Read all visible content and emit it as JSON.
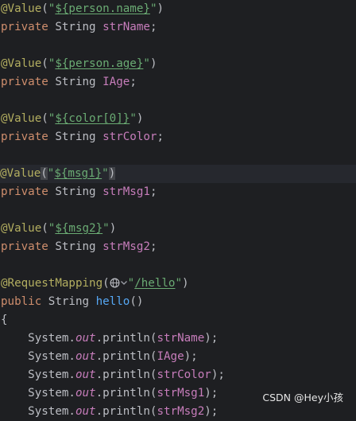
{
  "code": {
    "l1": {
      "anno": "@Value",
      "open": "(",
      "q1": "\"",
      "expr": "${person.name}",
      "q2": "\"",
      "close": ")"
    },
    "l2": {
      "kw": "private",
      "type": "String",
      "field": "strName",
      "semi": ";"
    },
    "l3": {
      "anno": "@Value",
      "open": "(",
      "q1": "\"",
      "expr": "${person.age}",
      "q2": "\"",
      "close": ")"
    },
    "l4": {
      "kw": "private",
      "type": "String",
      "field": "IAge",
      "semi": ";"
    },
    "l5": {
      "anno": "@Value",
      "open": "(",
      "q1": "\"",
      "expr": "${color[0]}",
      "q2": "\"",
      "close": ")"
    },
    "l6": {
      "kw": "private",
      "type": "String",
      "field": "strColor",
      "semi": ";"
    },
    "l7": {
      "anno": "@Value",
      "open": "(",
      "q1": "\"",
      "expr": "${msg1}",
      "q2": "\"",
      "close": ")"
    },
    "l8": {
      "kw": "private",
      "type": "String",
      "field": "strMsg1",
      "semi": ";"
    },
    "l9": {
      "anno": "@Value",
      "open": "(",
      "q1": "\"",
      "expr": "${msg2}",
      "q2": "\"",
      "close": ")"
    },
    "l10": {
      "kw": "private",
      "type": "String",
      "field": "strMsg2",
      "semi": ";"
    },
    "l11": {
      "anno": "@RequestMapping",
      "open": "(",
      "q1": "\"",
      "path": "/hello",
      "q2": "\"",
      "close": ")"
    },
    "l12": {
      "kw": "public",
      "type": "String",
      "method": "hello",
      "parens": "()"
    },
    "l13": {
      "brace": "{"
    },
    "p1": {
      "cls": "System",
      "dot": ".",
      "out": "out",
      "call": ".println(",
      "arg": "strName",
      "end": ");"
    },
    "p2": {
      "cls": "System",
      "dot": ".",
      "out": "out",
      "call": ".println(",
      "arg": "IAge",
      "end": ");"
    },
    "p3": {
      "cls": "System",
      "dot": ".",
      "out": "out",
      "call": ".println(",
      "arg": "strColor",
      "end": ");"
    },
    "p4": {
      "cls": "System",
      "dot": ".",
      "out": "out",
      "call": ".println(",
      "arg": "strMsg1",
      "end": ");"
    },
    "p5": {
      "cls": "System",
      "dot": ".",
      "out": "out",
      "call": ".println(",
      "arg": "strMsg2",
      "end": ");"
    }
  },
  "icons": {
    "url_icon": "globe-icon",
    "dropdown_icon": "chevron-down-icon"
  },
  "watermark": "CSDN @Hey小孩",
  "colors": {
    "background": "#1e1f22",
    "annotation": "#b3ae60",
    "keyword": "#cf8e6d",
    "field": "#c77dbb",
    "string": "#6aab73",
    "method": "#56a8f5",
    "text": "#bcbec4"
  }
}
